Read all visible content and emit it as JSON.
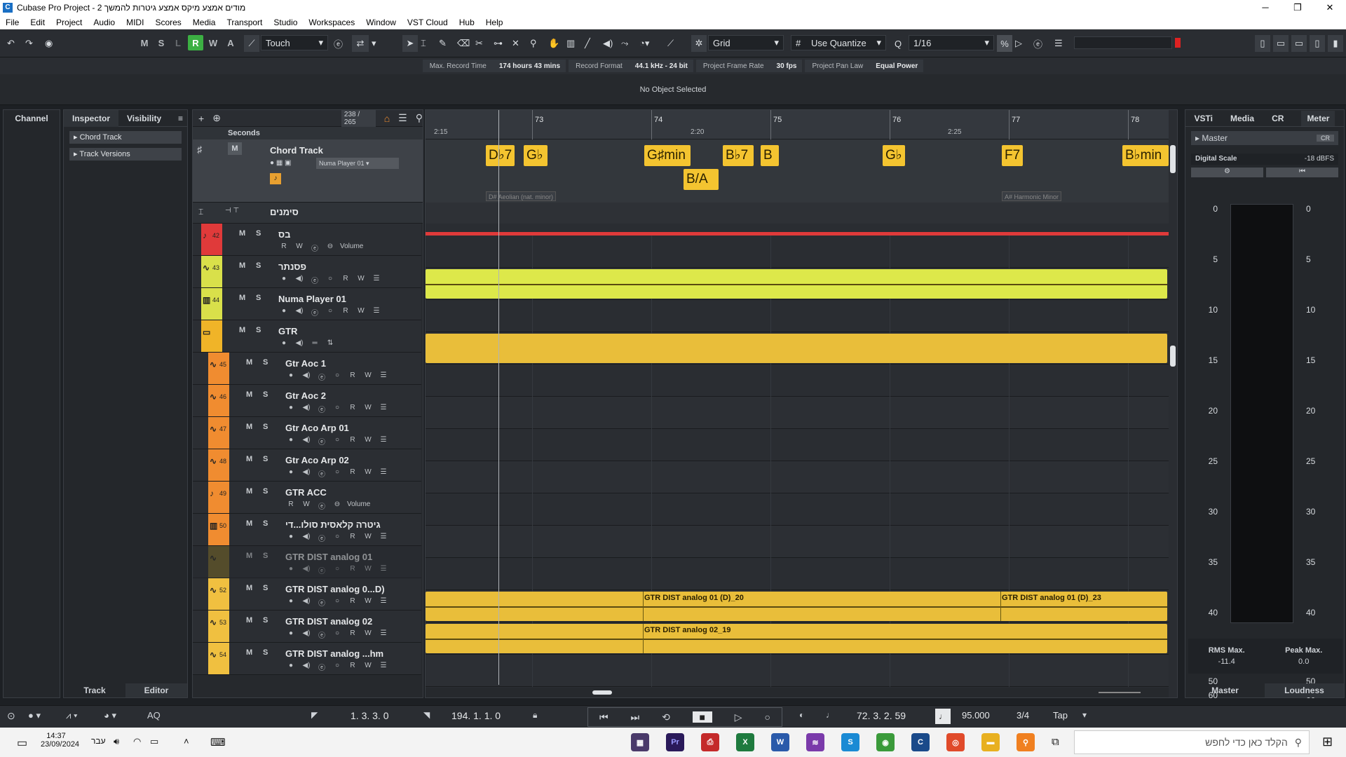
{
  "window": {
    "title": "Cubase Pro Project - מודים אמצע מיקס אמצע גיטרות להמשך 2",
    "minimize": "─",
    "maximize": "❐",
    "close": "✕"
  },
  "menu": [
    "File",
    "Edit",
    "Project",
    "Audio",
    "MIDI",
    "Scores",
    "Media",
    "Transport",
    "Studio",
    "Workspaces",
    "Window",
    "VST Cloud",
    "Hub",
    "Help"
  ],
  "toolbar": {
    "m": "M",
    "s": "S",
    "l": "L",
    "r": "R",
    "w": "W",
    "a": "A",
    "automation_mode": "Touch",
    "snap_type": "Grid",
    "quantize_mode": "Use Quantize",
    "quantize_value": "1/16"
  },
  "info_line": [
    {
      "label": "Max. Record Time",
      "value": "174 hours 43 mins"
    },
    {
      "label": "Record Format",
      "value": "44.1 kHz - 24 bit"
    },
    {
      "label": "Project Frame Rate",
      "value": "30 fps"
    },
    {
      "label": "Project Pan Law",
      "value": "Equal Power"
    }
  ],
  "selection_status": "No Object Selected",
  "left_zone": {
    "channel_tab": "Channel",
    "inspector_tab": "Inspector",
    "visibility_tab": "Visibility",
    "sections": [
      "Chord Track",
      "Track Versions"
    ],
    "bottom_tabs": [
      "Track",
      "Editor"
    ]
  },
  "track_list": {
    "count": "238 / 265",
    "ruler_mode": "Seconds",
    "chord_track": {
      "name": "Chord Track",
      "player": "Numa Player 01"
    },
    "marker_track": {
      "name": "סימנים"
    },
    "tracks": [
      {
        "num": "42",
        "name": "בס",
        "color": "#e03a3a",
        "sub": "Volume",
        "type": "midi"
      },
      {
        "num": "43",
        "name": "פסנתר",
        "color": "#d9e04a",
        "type": "audio"
      },
      {
        "num": "44",
        "name": "Numa Player 01",
        "color": "#d9e04a",
        "type": "instrument"
      },
      {
        "num": "",
        "name": "GTR",
        "color": "#f0b428",
        "type": "folder"
      },
      {
        "num": "45",
        "name": "Gtr Aoc 1",
        "color": "#f08c30",
        "type": "audio"
      },
      {
        "num": "46",
        "name": "Gtr Aoc 2",
        "color": "#f08c30",
        "type": "audio"
      },
      {
        "num": "47",
        "name": "Gtr Aco Arp  01",
        "color": "#f08c30",
        "type": "audio"
      },
      {
        "num": "48",
        "name": "Gtr Aco Arp  02",
        "color": "#f08c30",
        "type": "audio"
      },
      {
        "num": "49",
        "name": "GTR ACC",
        "color": "#f08c30",
        "sub": "Volume",
        "type": "midi"
      },
      {
        "num": "50",
        "name": "גיטרה קלאסית סולו...די",
        "color": "#f08c30",
        "type": "instrument"
      },
      {
        "num": "",
        "name": "GTR DIST analog 01",
        "color": "#7a6a2a",
        "type": "audio-disabled"
      },
      {
        "num": "52",
        "name": "GTR DIST analog 0...D)",
        "color": "#f0c040",
        "type": "audio"
      },
      {
        "num": "53",
        "name": "GTR DIST analog 02",
        "color": "#f0c040",
        "type": "audio"
      },
      {
        "num": "54",
        "name": "GTR DIST analog ...hm",
        "color": "#f0c040",
        "type": "audio"
      }
    ]
  },
  "ruler": {
    "bars": [
      "73",
      "74",
      "75",
      "76",
      "77",
      "78"
    ],
    "times": [
      "2:15",
      "2:20",
      "2:25"
    ]
  },
  "chords": [
    {
      "label": "D♭7"
    },
    {
      "label": "G♭"
    },
    {
      "label": "G♯min"
    },
    {
      "label": "B/A"
    },
    {
      "label": "B♭7"
    },
    {
      "label": "B"
    },
    {
      "label": "G♭"
    },
    {
      "label": "F7"
    },
    {
      "label": "B♭min"
    }
  ],
  "scales": [
    "D# Aeolian (nat. minor)",
    "A# Harmonic Minor"
  ],
  "clips": {
    "gtr_dist_52": [
      "GTR DIST analog 01 (D)_20",
      "GTR DIST analog 01 (D)_23"
    ],
    "gtr_dist_53": [
      "GTR DIST analog 02_19"
    ]
  },
  "right_zone": {
    "tabs": [
      "VSTi",
      "Media",
      "CR",
      "Meter"
    ],
    "master_label": "Master",
    "cr_label": "CR",
    "digital_scale": "Digital Scale",
    "dbfs": "-18 dBFS",
    "scale_marks": [
      "0",
      "5",
      "10",
      "15",
      "20",
      "25",
      "30",
      "35",
      "40",
      "50",
      "60"
    ],
    "rms_label": "RMS Max.",
    "rms_value": "-11.4",
    "peak_label": "Peak Max.",
    "peak_value": "0.0",
    "bottom_tabs": [
      "Master",
      "Loudness"
    ]
  },
  "transport": {
    "left_locator": "1. 3. 3.   0",
    "right_locator": "194. 1. 1.   0",
    "position": "72. 3. 2. 59",
    "tempo": "95.000",
    "signature": "3/4",
    "tap": "Tap",
    "aq": "AQ"
  },
  "taskbar": {
    "time": "14:37",
    "date": "23/09/2024",
    "lang": "עבר",
    "search_placeholder": "הקלד כאן כדי לחפש",
    "apps": [
      "Pr",
      "X",
      "W",
      "S"
    ]
  },
  "colors": {
    "chord": "#f4c430",
    "clip_yellow": "#e9be3a",
    "clip_lime": "#dde84a",
    "cursor_red": "#e03a3a"
  }
}
